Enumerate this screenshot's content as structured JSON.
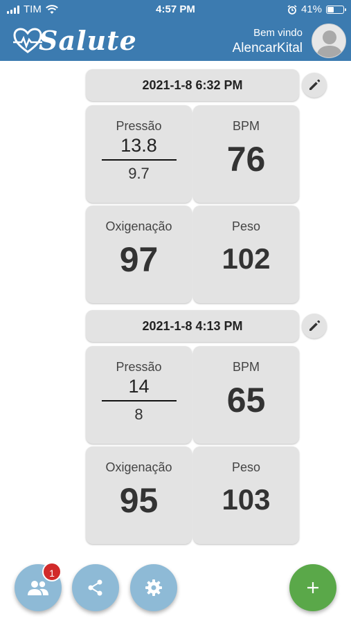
{
  "status_bar": {
    "carrier": "TIM",
    "time": "4:57 PM",
    "battery": "41%",
    "battery_level": 0.41
  },
  "header": {
    "brand": "Salute",
    "welcome": "Bem vindo",
    "username": "AlencarKital"
  },
  "records": [
    {
      "date": "2021-1-8 6:32 PM",
      "pressure_label": "Pressão",
      "pressure_sys": "13.8",
      "pressure_dia": "9.7",
      "bpm_label": "BPM",
      "bpm": "76",
      "oxygen_label": "Oxigenação",
      "oxygen": "97",
      "weight_label": "Peso",
      "weight": "102"
    },
    {
      "date": "2021-1-8 4:13 PM",
      "pressure_label": "Pressão",
      "pressure_sys": "14",
      "pressure_dia": "8",
      "bpm_label": "BPM",
      "bpm": "65",
      "oxygen_label": "Oxigenação",
      "oxygen": "95",
      "weight_label": "Peso",
      "weight": "103"
    }
  ],
  "bottom_bar": {
    "contacts_badge": "1"
  },
  "colors": {
    "header": "#3c7bb0",
    "card": "#e3e3e3",
    "fab": "#8ebad6",
    "add": "#5aa849",
    "badge": "#d12a2a"
  }
}
